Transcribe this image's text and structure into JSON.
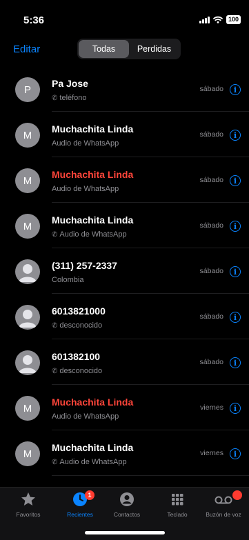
{
  "status": {
    "time": "5:36",
    "battery": "100"
  },
  "header": {
    "edit": "Editar",
    "tabs": [
      "Todas",
      "Perdidas"
    ],
    "active_tab": 0
  },
  "calls": [
    {
      "avatar": "P",
      "name": "Pa Jose",
      "detail": "teléfono",
      "phone_icon": true,
      "missed": false,
      "day": "sábado"
    },
    {
      "avatar": "M",
      "name": "Muchachita Linda",
      "detail": "Audio de WhatsApp",
      "phone_icon": false,
      "missed": false,
      "day": "sábado"
    },
    {
      "avatar": "M",
      "name": "Muchachita Linda",
      "detail": "Audio de WhatsApp",
      "phone_icon": false,
      "missed": true,
      "day": "sábado"
    },
    {
      "avatar": "M",
      "name": "Muchachita Linda",
      "detail": "Audio de WhatsApp",
      "phone_icon": true,
      "missed": false,
      "day": "sábado"
    },
    {
      "avatar": "person",
      "name": "(311) 257-2337",
      "detail": "Colombia",
      "phone_icon": false,
      "missed": false,
      "day": "sábado"
    },
    {
      "avatar": "person",
      "name": "6013821000",
      "detail": "desconocido",
      "phone_icon": true,
      "missed": false,
      "day": "sábado"
    },
    {
      "avatar": "person",
      "name": "601382100",
      "detail": "desconocido",
      "phone_icon": true,
      "missed": false,
      "day": "sábado"
    },
    {
      "avatar": "M",
      "name": "Muchachita Linda",
      "detail": "Audio de WhatsApp",
      "phone_icon": false,
      "missed": true,
      "day": "viernes"
    },
    {
      "avatar": "M",
      "name": "Muchachita Linda",
      "detail": "Audio de WhatsApp",
      "phone_icon": true,
      "missed": false,
      "day": "viernes"
    }
  ],
  "tabbar": {
    "items": [
      {
        "label": "Favoritos",
        "icon": "star-icon",
        "badge": ""
      },
      {
        "label": "Recientes",
        "icon": "clock-icon",
        "badge": "1"
      },
      {
        "label": "Contactos",
        "icon": "person-circle-icon",
        "badge": ""
      },
      {
        "label": "Teclado",
        "icon": "keypad-icon",
        "badge": ""
      },
      {
        "label": "Buzón de voz",
        "icon": "voicemail-icon",
        "badge": " "
      }
    ],
    "active": 1
  },
  "colors": {
    "accent": "#0a84ff",
    "missed": "#ff453a",
    "secondary_text": "#8e8e93",
    "badge": "#ff3b30"
  }
}
